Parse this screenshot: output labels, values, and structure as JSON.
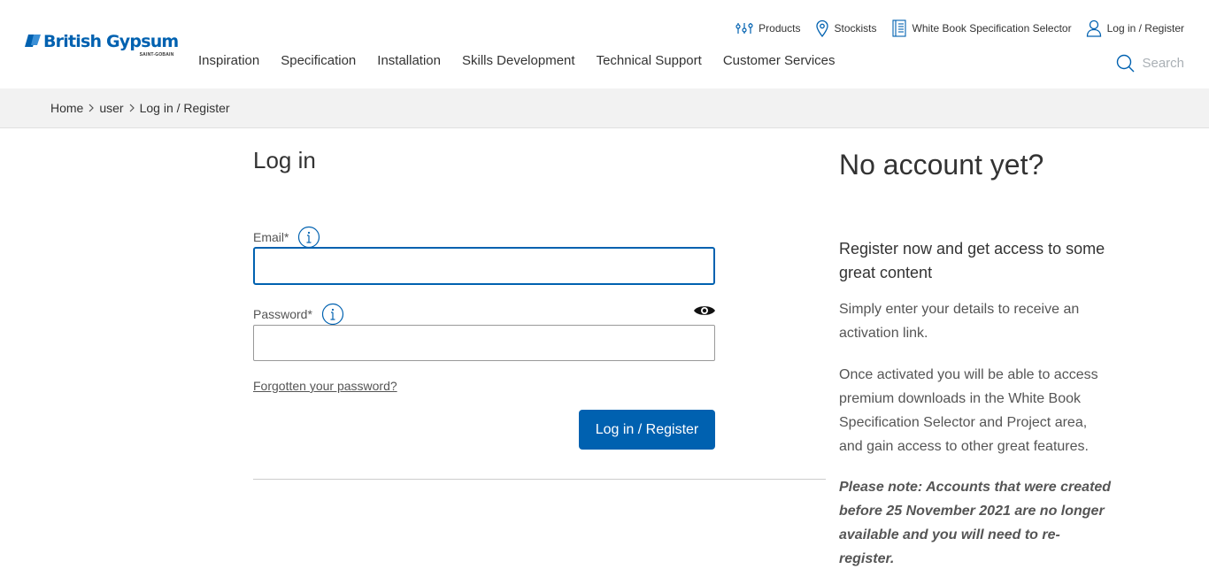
{
  "brand": {
    "name": "British Gypsum",
    "sub": "SAINT-GOBAIN",
    "color": "#0061b0"
  },
  "utility_nav": [
    {
      "label": "Products",
      "icon": "products-icon"
    },
    {
      "label": "Stockists",
      "icon": "location-pin-icon"
    },
    {
      "label": "White Book Specification Selector",
      "icon": "book-icon"
    },
    {
      "label": "Log in / Register",
      "icon": "user-icon"
    }
  ],
  "main_nav": [
    "Inspiration",
    "Specification",
    "Installation",
    "Skills Development",
    "Technical Support",
    "Customer Services"
  ],
  "search": {
    "placeholder": "Search",
    "icon": "search-icon"
  },
  "breadcrumb": [
    "Home",
    "user",
    "Log in / Register"
  ],
  "login": {
    "title": "Log in",
    "email_label": "Email*",
    "email_value": "",
    "password_label": "Password*",
    "password_value": "",
    "forgot_link": "Forgotten your password?",
    "submit_label": "Log in / Register"
  },
  "register": {
    "title": "No account yet?",
    "subtitle": "Register now and get access to some great content",
    "para1": "Simply enter your details to receive an activation link.",
    "para2": "Once activated you will be able to access premium downloads in the White Book Specification Selector and Project area, and gain access to other great features.",
    "note": "Please note: Accounts that were created before 25 November 2021 are no longer available and you will need to re-register."
  }
}
